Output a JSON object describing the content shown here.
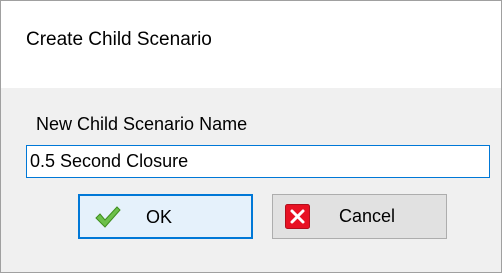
{
  "dialog": {
    "title": "Create Child Scenario",
    "name_label": "New Child Scenario Name",
    "name_value": "0.5 Second Closure",
    "ok_label": "OK",
    "cancel_label": "Cancel"
  },
  "icons": {
    "ok": "green-checkmark-icon",
    "cancel": "red-x-icon"
  },
  "colors": {
    "focus_accent": "#0078d7",
    "check_green": "#5cb82c",
    "cancel_red": "#e81123"
  }
}
